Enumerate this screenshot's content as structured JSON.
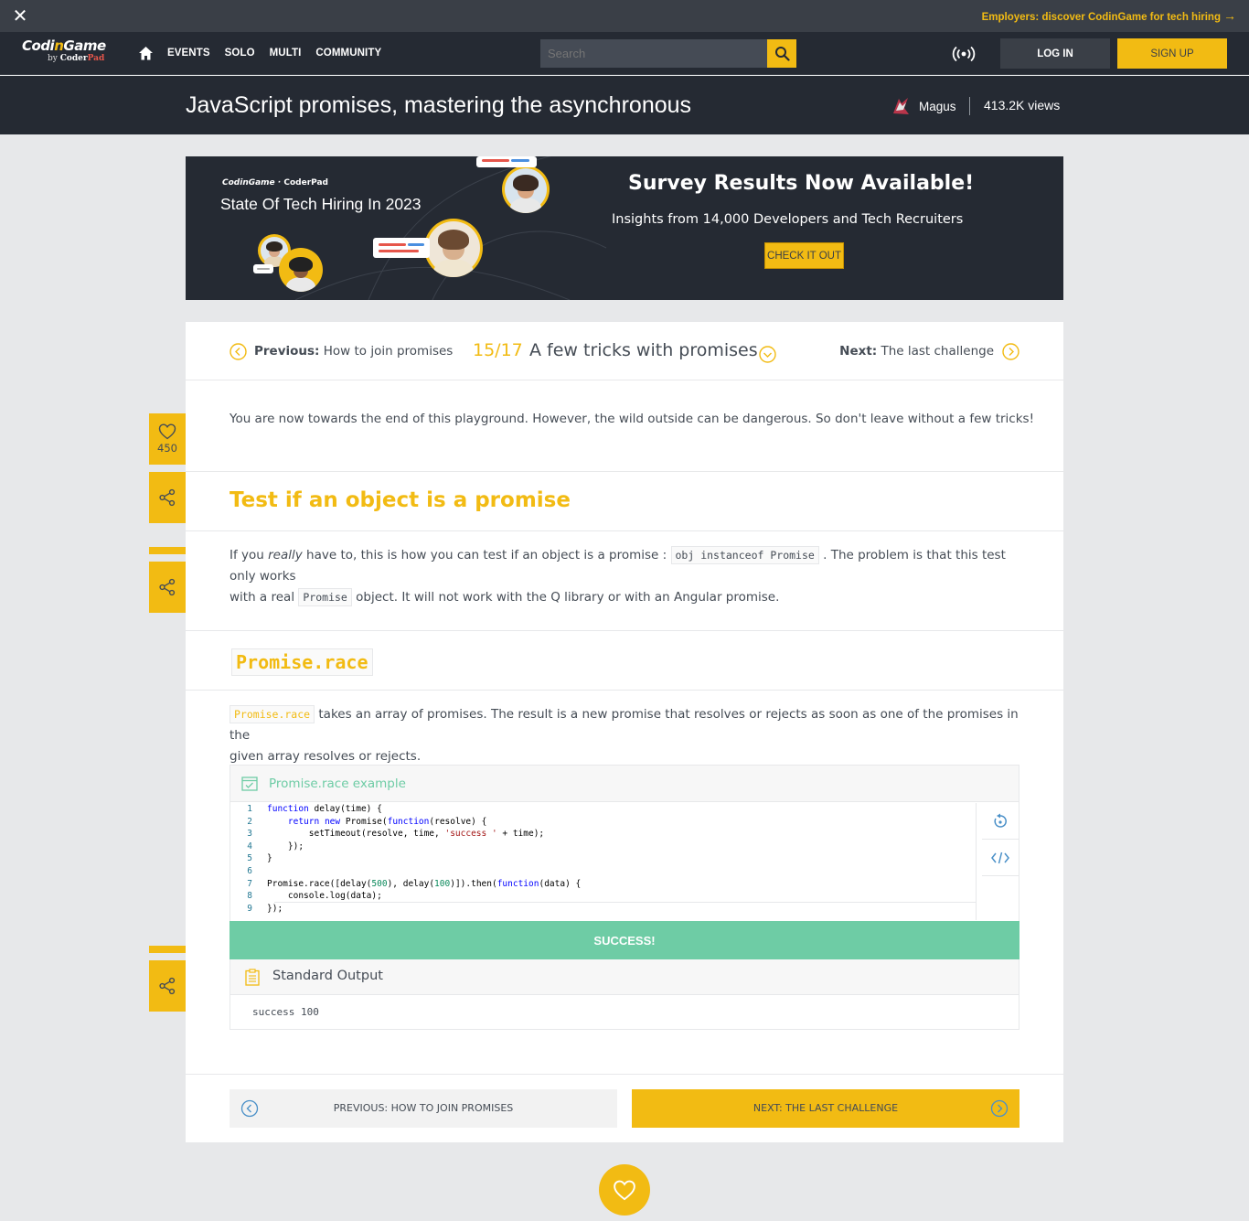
{
  "promo": {
    "close_icon": "close-icon",
    "link_label": "Employers: discover CodinGame for tech hiring",
    "link_arrow": "→"
  },
  "nav": {
    "logo_main_a": "Codi",
    "logo_main_b": "n",
    "logo_main_c": "Game",
    "logo_by": "by ",
    "logo_coder": "Coder",
    "logo_pad": "Pad",
    "links": [
      "EVENTS",
      "SOLO",
      "MULTI",
      "COMMUNITY"
    ],
    "search_placeholder": "Search",
    "login_label": "LOG IN",
    "signup_label": "SIGN UP",
    "accent_color": "#f2bb13"
  },
  "header": {
    "title": "JavaScript promises, mastering the asynchronous",
    "author": "Magus",
    "views": "413.2K views"
  },
  "banner": {
    "brand_a": "CodinGame",
    "brand_sep": " · ",
    "brand_b": "CoderPad",
    "subtitle": "State Of Tech Hiring In 2023",
    "title": "Survey Results Now Available!",
    "description": "Insights from 14,000 Developers and Tech Recruiters",
    "cta": "CHECK IT OUT"
  },
  "lesson_nav": {
    "prev_prefix": "Previous:",
    "prev_title": "How to join promises",
    "counter": "15/17",
    "current_title": "A few tricks with promises",
    "next_prefix": "Next:",
    "next_title": "The last challenge"
  },
  "content": {
    "intro": "You are now towards the end of this playground. However, the wild outside can be dangerous. So don't leave without a few tricks!",
    "section1_title": "Test if an object is a promise",
    "s1_p1_a": "If you ",
    "s1_p1_em": "really",
    "s1_p1_b": " have to, this is how you can test if an object is a promise : ",
    "s1_code1": "obj instanceof Promise",
    "s1_p1_c": " . The problem is that this test only works",
    "s1_p2_a": "with a real ",
    "s1_code2": "Promise",
    "s1_p2_b": " object. It will not work with the Q library or with an Angular promise.",
    "section2_title": "Promise.race",
    "s2_code": "Promise.race",
    "s2_p1": " takes an array of promises. The result is a new promise that resolves or rejects as soon as one of the promises in the",
    "s2_p2": "given array resolves or rejects."
  },
  "code_block": {
    "label": "Promise.race example",
    "lines": [
      "1",
      "2",
      "3",
      "4",
      "5",
      "6",
      "7",
      "8",
      "9"
    ],
    "success_label": "SUCCESS!",
    "output_label": "Standard Output",
    "output_text": "success 100",
    "reset_icon": "reset-icon",
    "code_icon": "code-icon"
  },
  "bottom_nav": {
    "prev_label": "PREVIOUS: HOW TO JOIN PROMISES",
    "next_label": "NEXT: THE LAST CHALLENGE"
  },
  "sidebar": {
    "like_count": "450"
  }
}
